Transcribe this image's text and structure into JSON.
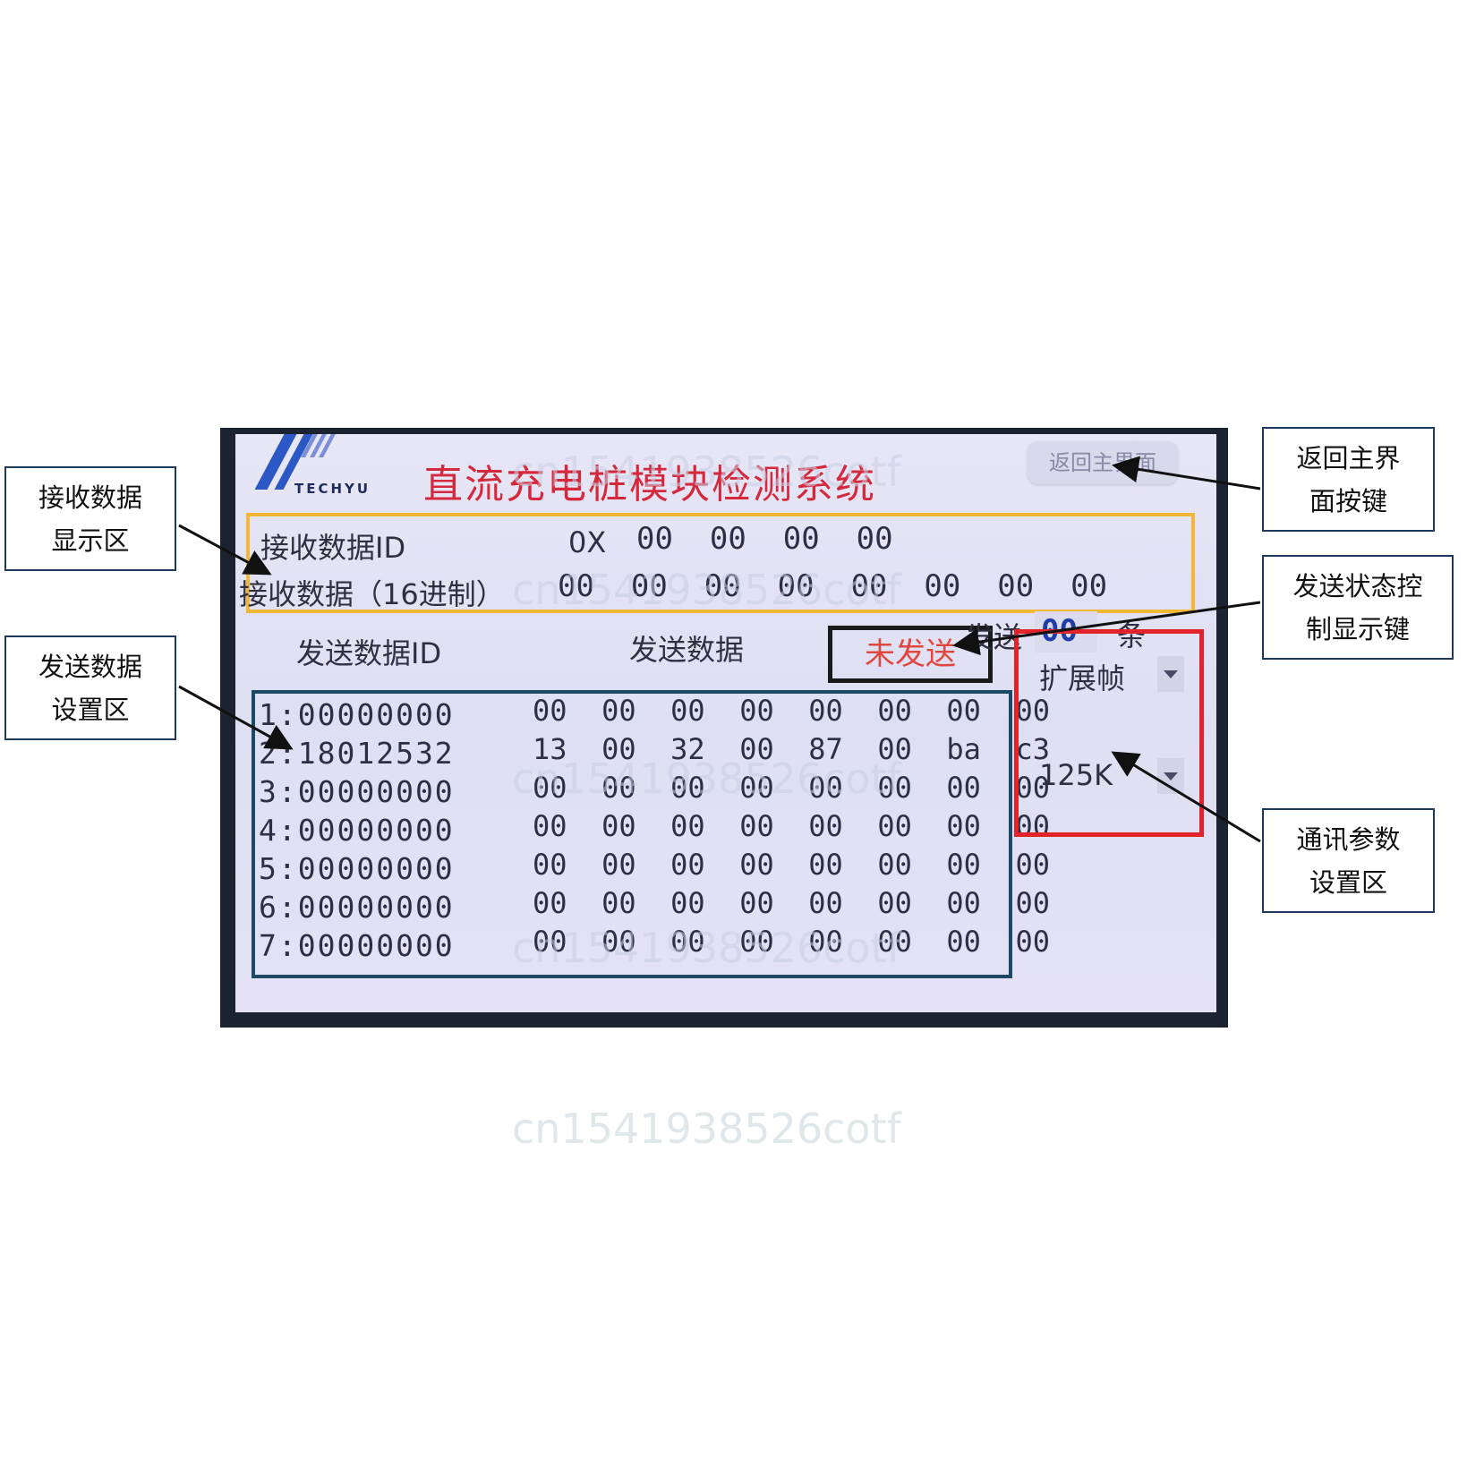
{
  "screen": {
    "logo_text": "TECHYU",
    "title": "直流充电桩模块检测系统",
    "back_button": "返回主界面"
  },
  "receive": {
    "id_label": "接收数据ID",
    "id_prefix": "0X",
    "id_value": "00  00  00  00",
    "data_label": "接收数据（16进制）",
    "data_value": "00  00  00  00  00  00  00  00"
  },
  "send": {
    "id_header": "发送数据ID",
    "data_header": "发送数据",
    "status": "未发送",
    "count_prefix": "发送",
    "count_value": "00",
    "count_suffix": "条",
    "rows": [
      {
        "id": "1:00000000",
        "data": "00  00  00  00  00  00  00  00"
      },
      {
        "id": "2:18012532",
        "data": "13  00  32  00  87  00  ba  c3"
      },
      {
        "id": "3:00000000",
        "data": "00  00  00  00  00  00  00  00"
      },
      {
        "id": "4:00000000",
        "data": "00  00  00  00  00  00  00  00"
      },
      {
        "id": "5:00000000",
        "data": "00  00  00  00  00  00  00  00"
      },
      {
        "id": "6:00000000",
        "data": "00  00  00  00  00  00  00  00"
      },
      {
        "id": "7:00000000",
        "data": "00  00  00  00  00  00  00  00"
      }
    ]
  },
  "comm": {
    "frame_type": "扩展帧",
    "baud_rate": "125K"
  },
  "callouts": {
    "recv_area": [
      "接收数据",
      "显示区"
    ],
    "send_area": [
      "发送数据",
      "设置区"
    ],
    "back_key": [
      "返回主界",
      "面按键"
    ],
    "status_key": [
      "发送状态控",
      "制显示键"
    ],
    "comm_area": [
      "通讯参数",
      "设置区"
    ]
  },
  "watermark": "cn1541938526cotf",
  "colors": {
    "recv_frame": "#f2b834",
    "send_frame": "#1c4a64",
    "status_frame": "#1a1a1a",
    "comm_frame": "#e2242a",
    "title": "#d4293c",
    "status_text": "#e0473e",
    "count_text": "#1f3fa8"
  }
}
